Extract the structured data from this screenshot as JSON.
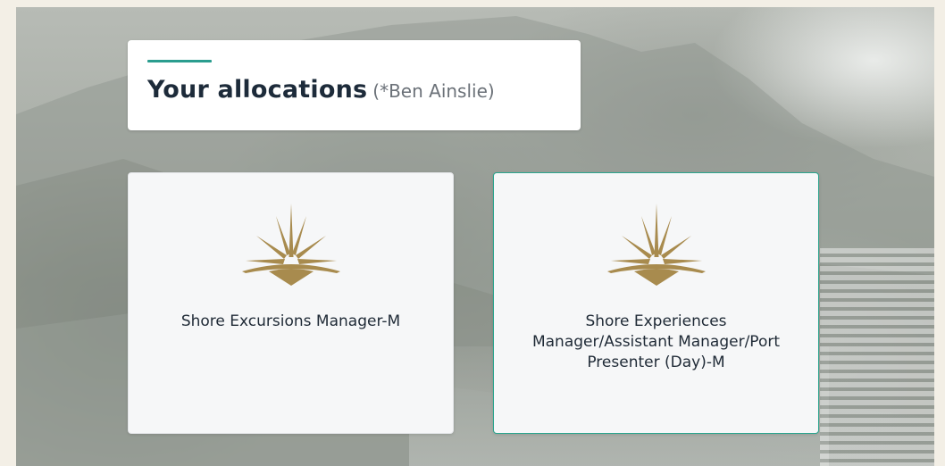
{
  "header": {
    "title": "Your allocations",
    "subtitle": "(*Ben Ainslie)"
  },
  "colors": {
    "accent": "#2a9d8f",
    "logo_gold": "#a88b4e",
    "selected_border": "#2aa58e"
  },
  "allocations": [
    {
      "icon": "sunburst-logo-icon",
      "label": "Shore Excursions Manager-M",
      "selected": false
    },
    {
      "icon": "sunburst-logo-icon",
      "label": "Shore Experiences Manager/Assistant Manager/Port Presenter (Day)-M",
      "selected": true
    }
  ]
}
